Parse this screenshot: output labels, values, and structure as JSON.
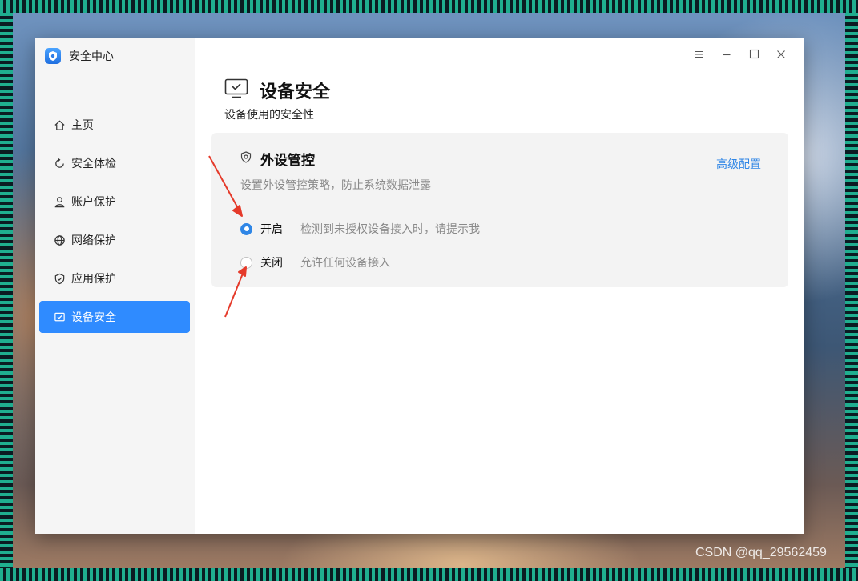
{
  "app": {
    "title": "安全中心"
  },
  "window_controls": {
    "menu_icon": "menu-icon",
    "minimize_icon": "minimize-icon",
    "maximize_icon": "maximize-icon",
    "close_icon": "close-icon"
  },
  "sidebar": {
    "items": [
      {
        "label": "主页",
        "icon": "home-icon"
      },
      {
        "label": "安全体检",
        "icon": "refresh-icon"
      },
      {
        "label": "账户保护",
        "icon": "user-icon"
      },
      {
        "label": "网络保护",
        "icon": "globe-icon"
      },
      {
        "label": "应用保护",
        "icon": "shield-check-icon"
      },
      {
        "label": "设备安全",
        "icon": "monitor-check-icon",
        "active": true
      }
    ]
  },
  "page": {
    "title": "设备安全",
    "subtitle": "设备使用的安全性"
  },
  "card": {
    "title": "外设管控",
    "description": "设置外设管控策略，防止系统数据泄露",
    "advanced_link": "高级配置",
    "options": [
      {
        "label": "开启",
        "description": "检测到未授权设备接入时，请提示我",
        "checked": true
      },
      {
        "label": "关闭",
        "description": "允许任何设备接入",
        "checked": false
      }
    ]
  },
  "watermark": "CSDN @qq_29562459",
  "colors": {
    "accent": "#2f8bff",
    "link": "#2f86e6",
    "annotation_arrow": "#e53a2a"
  }
}
